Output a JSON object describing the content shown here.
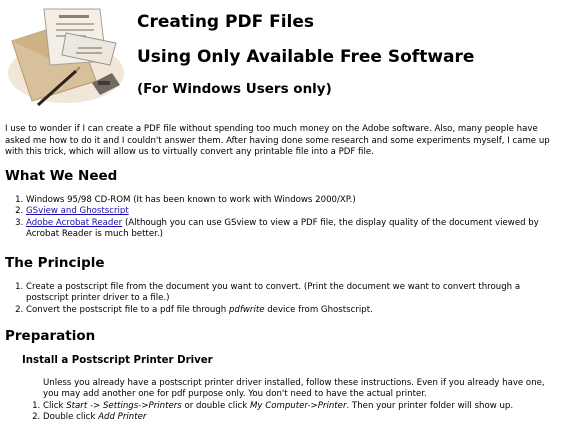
{
  "header": {
    "title_line1": "Creating PDF Files",
    "title_line2": "Using Only Available Free Software",
    "title_line3": "(For Windows Users only)"
  },
  "intro": "I use to wonder if I can create a PDF file without spending too much money on the Adobe software. Also, many people have asked me how to do it and I couldn't answer them. After having done some research and some experiments myself, I came up with this trick, which will allow us to virtually convert any printable file into a PDF file.",
  "what_we_need": {
    "heading": "What We Need",
    "item1": "Windows 95/98 CD-ROM (It has been known to work with Windows 2000/XP.)",
    "item2_link": "GSview and Ghostscript",
    "item3_link": "Adobe Acrobat Reader",
    "item3_text": " (Although you can use GSview to view a PDF file, the display quality of the document viewed by Acrobat Reader is much better.)"
  },
  "principle": {
    "heading": "The Principle",
    "item1": "Create a postscript file from the document you want to convert. (Print the document we want to convert through a postscript printer driver to a file.)",
    "item2_before": "Convert the postscript file to a pdf file through ",
    "item2_italic": "pdfwrite",
    "item2_after": " device from Ghostscript."
  },
  "preparation": {
    "heading": "Preparation",
    "subheading": "Install a Postscript Printer Driver",
    "text": "Unless you already have a postscript printer driver installed, follow these instructions. Even if you already have one, you may add another one for pdf purpose only. You don't need to have the actual printer.",
    "step1_a": "Click ",
    "step1_b": "Start -> Settings->Printers",
    "step1_c": " or double click ",
    "step1_d": "My Computer->Printer",
    "step1_e": ". Then your printer folder will show up.",
    "step2_a": "Double click ",
    "step2_b": "Add Printer"
  }
}
